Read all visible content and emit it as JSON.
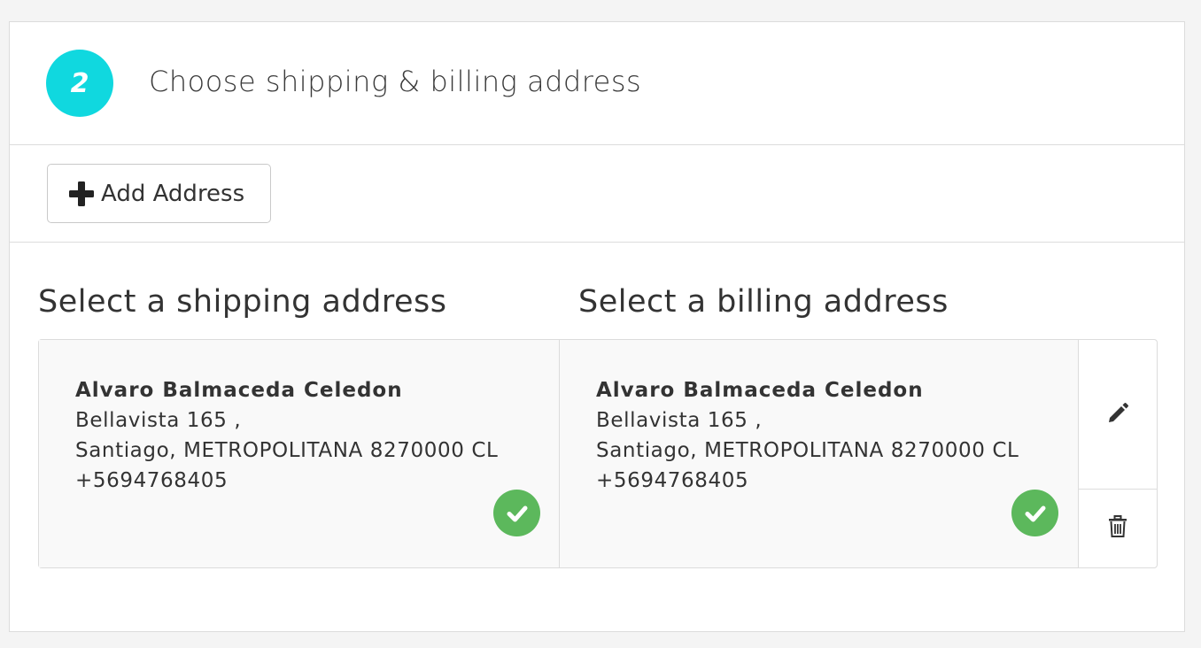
{
  "step": {
    "number": "2",
    "title": "Choose shipping & billing address",
    "accent": "#10d8df"
  },
  "toolbar": {
    "add_label": "Add Address",
    "add_icon": "plus-icon"
  },
  "shipping": {
    "heading": "Select a shipping address",
    "card": {
      "name": "Alvaro Balmaceda Celedon",
      "street": "Bellavista 165 ,",
      "city_line": "Santiago, METROPOLITANA 8270000 CL",
      "phone": "+5694768405",
      "selected_icon": "check-circle-icon"
    }
  },
  "billing": {
    "heading": "Select a billing address",
    "card": {
      "name": "Alvaro Balmaceda Celedon",
      "street": "Bellavista 165 ,",
      "city_line": "Santiago, METROPOLITANA 8270000 CL",
      "phone": "+5694768405",
      "selected_icon": "check-circle-icon"
    }
  },
  "actions": {
    "edit_icon": "pencil-icon",
    "delete_icon": "trash-icon"
  },
  "colors": {
    "selected": "#5cb85c",
    "border": "#dcdcdc",
    "card_bg": "#f9f9f9"
  }
}
